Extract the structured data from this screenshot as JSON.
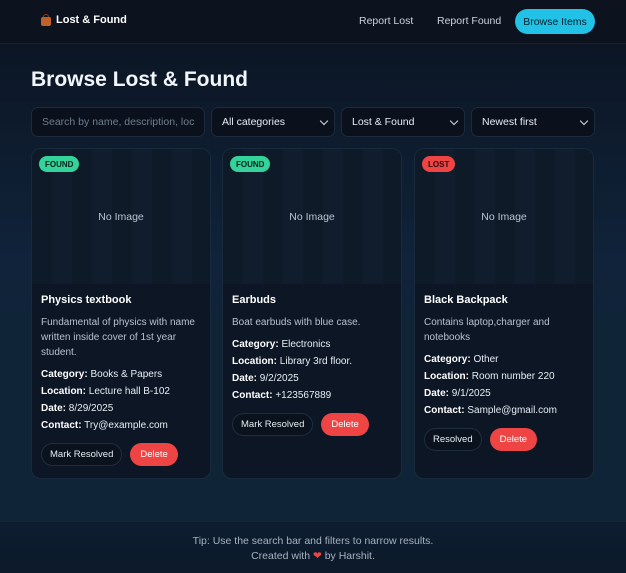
{
  "header": {
    "brand": "Lost & Found",
    "nav": {
      "report_lost": "Report Lost",
      "report_found": "Report Found",
      "browse_items": "Browse Items"
    }
  },
  "main": {
    "title": "Browse Lost & Found",
    "filters": {
      "search_placeholder": "Search by name, description, loc",
      "category": "All categories",
      "type": "Lost & Found",
      "sort": "Newest first"
    }
  },
  "labels": {
    "no_image": "No Image",
    "category": "Category:",
    "location": "Location:",
    "date": "Date:",
    "contact": "Contact:",
    "delete": "Delete"
  },
  "items": [
    {
      "status": "FOUND",
      "title": "Physics textbook",
      "description": "Fundamental of physics with name written inside cover of 1st year student.",
      "category": "Books & Papers",
      "location": "Lecture hall B-102",
      "date": "8/29/2025",
      "contact": "Try@example.com",
      "resolve_label": "Mark Resolved"
    },
    {
      "status": "FOUND",
      "title": "Earbuds",
      "description": "Boat earbuds with blue case.",
      "category": "Electronics",
      "location": "Library 3rd floor.",
      "date": "9/2/2025",
      "contact": "+123567889",
      "resolve_label": "Mark Resolved"
    },
    {
      "status": "LOST",
      "title": "Black Backpack",
      "description": "Contains laptop,charger and notebooks",
      "category": "Other",
      "location": "Room number 220",
      "date": "9/1/2025",
      "contact": "Sample@gmail.com",
      "resolve_label": "Resolved"
    }
  ],
  "footer": {
    "tip": "Tip: Use the search bar and filters to narrow results.",
    "credit_before": "Created with",
    "credit_after": "by Harshit."
  },
  "colors": {
    "accent": "#22c1e6",
    "found": "#34d399",
    "lost": "#ef4444",
    "danger": "#ef4444"
  }
}
